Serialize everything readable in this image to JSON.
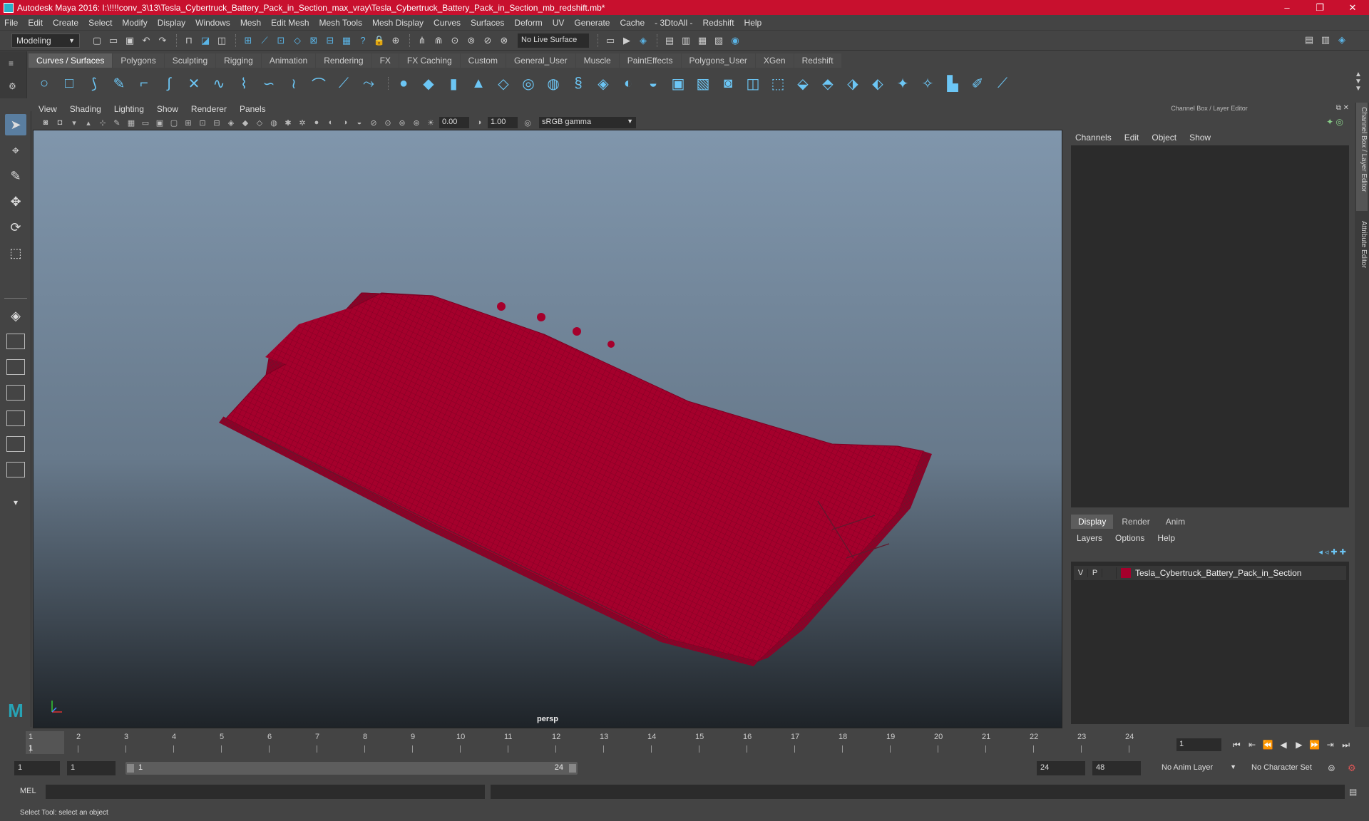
{
  "window": {
    "title": "Autodesk Maya 2016: I:\\!!!!conv_3\\13\\Tesla_Cybertruck_Battery_Pack_in_Section_max_vray\\Tesla_Cybertruck_Battery_Pack_in_Section_mb_redshift.mb*",
    "minimize": "–",
    "maximize": "❐",
    "close": "✕"
  },
  "menubar": [
    "File",
    "Edit",
    "Create",
    "Select",
    "Modify",
    "Display",
    "Windows",
    "Mesh",
    "Edit Mesh",
    "Mesh Tools",
    "Mesh Display",
    "Curves",
    "Surfaces",
    "Deform",
    "UV",
    "Generate",
    "Cache",
    "- 3DtoAll -",
    "Redshift",
    "Help"
  ],
  "statusline": {
    "mode": "Modeling",
    "live_surface": "No Live Surface"
  },
  "shelf": {
    "tabs": [
      "Curves / Surfaces",
      "Polygons",
      "Sculpting",
      "Rigging",
      "Animation",
      "Rendering",
      "FX",
      "FX Caching",
      "Custom",
      "General_User",
      "Muscle",
      "PaintEffects",
      "Polygons_User",
      "XGen",
      "Redshift"
    ],
    "active_tab": "Curves / Surfaces"
  },
  "viewport": {
    "menu": [
      "View",
      "Shading",
      "Lighting",
      "Show",
      "Renderer",
      "Panels"
    ],
    "exposure": "0.00",
    "gamma": "1.00",
    "color_space": "sRGB gamma",
    "camera": "persp",
    "mesh_color": "#a5002c"
  },
  "right_panel": {
    "title": "Channel Box / Layer Editor",
    "menu": [
      "Channels",
      "Edit",
      "Object",
      "Show"
    ],
    "tabs": [
      "Display",
      "Render",
      "Anim"
    ],
    "layer_menu": [
      "Layers",
      "Options",
      "Help"
    ],
    "layer": {
      "visible": "V",
      "playback": "P",
      "name": "Tesla_Cybertruck_Battery_Pack_in_Section",
      "color": "#a5002c"
    },
    "side_tabs": [
      "Channel Box / Layer Editor",
      "Attribute Editor"
    ]
  },
  "timeline": {
    "ticks": [
      "1",
      "2",
      "3",
      "4",
      "5",
      "6",
      "7",
      "8",
      "9",
      "10",
      "11",
      "12",
      "13",
      "14",
      "15",
      "16",
      "17",
      "18",
      "19",
      "20",
      "21",
      "22",
      "23",
      "24"
    ],
    "current_frame": "1",
    "current_frame_field": "1"
  },
  "range": {
    "start": "1",
    "playback_start": "1",
    "range_start_label": "1",
    "range_end_label": "24",
    "playback_end": "24",
    "end": "48",
    "anim_layer": "No Anim Layer",
    "character_set": "No Character Set"
  },
  "command": {
    "language": "MEL"
  },
  "help_line": "Select Tool: select an object"
}
